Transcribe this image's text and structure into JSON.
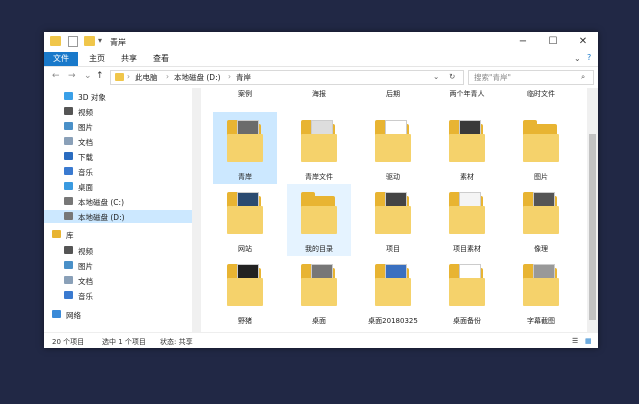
{
  "window": {
    "title": "青岸"
  },
  "ribbon": {
    "tabs": [
      "文件",
      "主页",
      "共享",
      "查看"
    ]
  },
  "nav_buttons": {
    "back": "←",
    "forward": "→",
    "recent": "⌄",
    "up": "↑"
  },
  "address": {
    "crumbs": [
      "此电脑",
      "本地磁盘 (D:)",
      "青岸"
    ],
    "sep": "›"
  },
  "search": {
    "placeholder": "搜索\"青岸\""
  },
  "sidebar": {
    "items": [
      {
        "label": "3D 对象",
        "icon": "3d-objects-icon",
        "color": "#3aa0e8"
      },
      {
        "label": "视频",
        "icon": "video-icon",
        "color": "#555555"
      },
      {
        "label": "图片",
        "icon": "pictures-icon",
        "color": "#4a90c8"
      },
      {
        "label": "文档",
        "icon": "documents-icon",
        "color": "#8aa0b8"
      },
      {
        "label": "下载",
        "icon": "download-icon",
        "color": "#2a6cc0"
      },
      {
        "label": "音乐",
        "icon": "music-icon",
        "color": "#3a7ad0"
      },
      {
        "label": "桌面",
        "icon": "desktop-icon",
        "color": "#3a9ae0"
      },
      {
        "label": "本地磁盘 (C:)",
        "icon": "drive-icon",
        "color": "#777777"
      },
      {
        "label": "本地磁盘 (D:)",
        "icon": "drive-icon",
        "color": "#777777",
        "selected": true
      },
      {
        "label": "库",
        "icon": "library-icon",
        "color": "#e8b432"
      },
      {
        "label": "视频",
        "icon": "video-icon",
        "color": "#555555"
      },
      {
        "label": "图片",
        "icon": "pictures-icon",
        "color": "#4a90c8"
      },
      {
        "label": "文档",
        "icon": "documents-icon",
        "color": "#8aa0b8"
      },
      {
        "label": "音乐",
        "icon": "music-icon",
        "color": "#3a7ad0"
      },
      {
        "label": "网络",
        "icon": "network-icon",
        "color": "#3a8ad8"
      }
    ]
  },
  "top_row_labels": [
    "案例",
    "海报",
    "后期",
    "两个年青人",
    "临时文件"
  ],
  "folders": [
    {
      "label": "青岸",
      "paper": "#6b6b6b",
      "selected": true
    },
    {
      "label": "青岸文件",
      "paper": "#dddddd"
    },
    {
      "label": "驱动",
      "paper": "#ffffff"
    },
    {
      "label": "素材",
      "paper": "#3a3a3a"
    },
    {
      "label": "图片",
      "paper": ""
    },
    {
      "label": "网站",
      "paper": "#2a4a70"
    },
    {
      "label": "我的目录",
      "paper": "",
      "hover": true
    },
    {
      "label": "项目",
      "paper": "#444444"
    },
    {
      "label": "项目素材",
      "paper": "#f4f4f4"
    },
    {
      "label": "像理",
      "paper": "#555555"
    },
    {
      "label": "野猪",
      "paper": "#222222"
    },
    {
      "label": "桌面",
      "paper": "#777777"
    },
    {
      "label": "桌面20180325",
      "paper": "#3a70c0"
    },
    {
      "label": "桌面备份",
      "paper": "#ffffff"
    },
    {
      "label": "字幕截图",
      "paper": "#999999"
    }
  ],
  "status": {
    "count": "20 个项目",
    "selected": "选中 1 个项目",
    "state": "状态: 共享"
  },
  "colors": {
    "accent": "#1979ca",
    "selection": "#cce8ff",
    "folder": "#f5d26b",
    "desktop_bg": "#212845"
  }
}
